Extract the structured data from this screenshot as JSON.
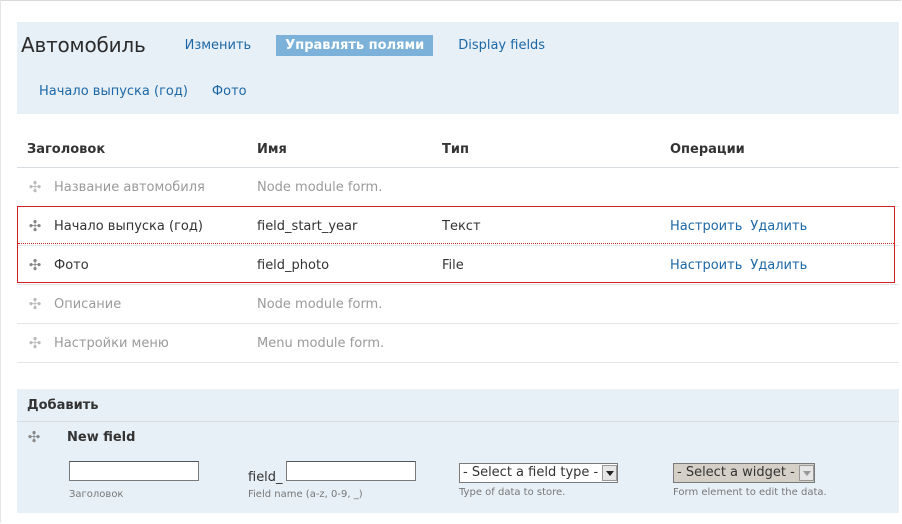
{
  "header": {
    "title": "Автомобиль",
    "tabs": [
      {
        "label": "Изменить",
        "active": false
      },
      {
        "label": "Управлять полями",
        "active": true
      },
      {
        "label": "Display fields",
        "active": false
      }
    ],
    "subtabs": [
      "Начало выпуска (год)",
      "Фото"
    ]
  },
  "table": {
    "headers": [
      "Заголовок",
      "Имя",
      "Тип",
      "Операции"
    ],
    "rows": [
      {
        "label": "Название автомобиля",
        "name": "Node module form.",
        "type": "",
        "ops": []
      },
      {
        "label": "Начало выпуска (год)",
        "name": "field_start_year",
        "type": "Текст",
        "ops": [
          "Настроить",
          "Удалить"
        ]
      },
      {
        "label": "Фото",
        "name": "field_photo",
        "type": "File",
        "ops": [
          "Настроить",
          "Удалить"
        ]
      },
      {
        "label": "Описание",
        "name": "Node module form.",
        "type": "",
        "ops": []
      },
      {
        "label": "Настройки меню",
        "name": "Menu module form.",
        "type": "",
        "ops": []
      }
    ]
  },
  "add": {
    "heading": "Добавить",
    "new_field": "New field",
    "label_input": {
      "value": "",
      "hint": "Заголовок"
    },
    "name_input": {
      "prefix": "field_",
      "value": "",
      "hint": "Field name (a-z, 0-9, _)"
    },
    "type_select": {
      "value": "- Select a field type -",
      "hint": "Type of data to store."
    },
    "widget_select": {
      "value": "- Select a widget -",
      "hint": "Form element to edit the data."
    }
  },
  "icons": {
    "drag": "drag-handle-icon"
  },
  "colors": {
    "link": "#1c67a6",
    "active_tab": "#7cb1d9",
    "panel": "#e8f0f7",
    "highlight": "#d42020"
  }
}
